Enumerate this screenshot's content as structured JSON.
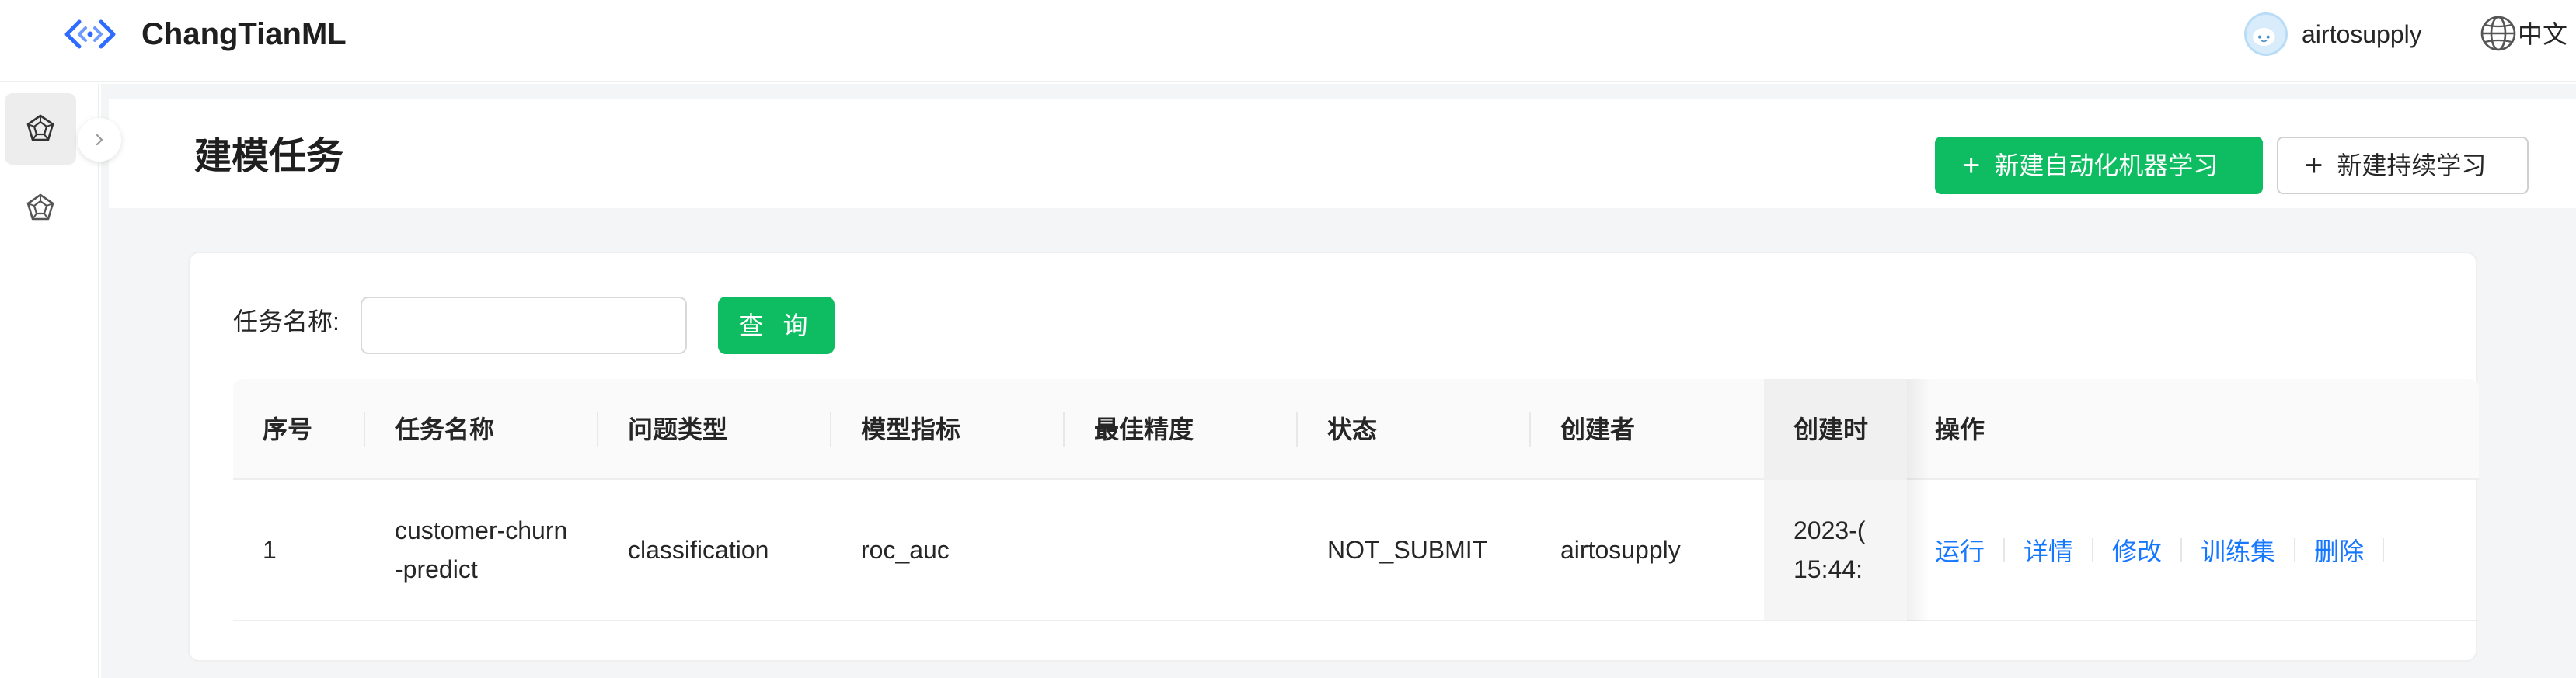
{
  "app": {
    "title": "ChangTianML"
  },
  "user": {
    "name": "airtosupply"
  },
  "language": {
    "label": "中文"
  },
  "page": {
    "title": "建模任务",
    "buttons": {
      "new_automl": "新建自动化机器学习",
      "new_continual": "新建持续学习"
    }
  },
  "search": {
    "label": "任务名称:",
    "value": "",
    "placeholder": "",
    "button": "查 询"
  },
  "table": {
    "columns": [
      "序号",
      "任务名称",
      "问题类型",
      "模型指标",
      "最佳精度",
      "状态",
      "创建者",
      "创建时",
      "操作"
    ],
    "rows": [
      {
        "index": "1",
        "name": "customer-churn-predict",
        "problem_type": "classification",
        "metric": "roc_auc",
        "best_score": "",
        "status": "NOT_SUBMIT",
        "creator": "airtosupply",
        "created_line1": "2023-(",
        "created_line2": "15:44:",
        "actions": [
          "运行",
          "详情",
          "修改",
          "训练集",
          "删除"
        ]
      }
    ]
  },
  "colors": {
    "primary": "#0ebc61",
    "link": "#1677ff",
    "logo": "#2f6bff"
  }
}
